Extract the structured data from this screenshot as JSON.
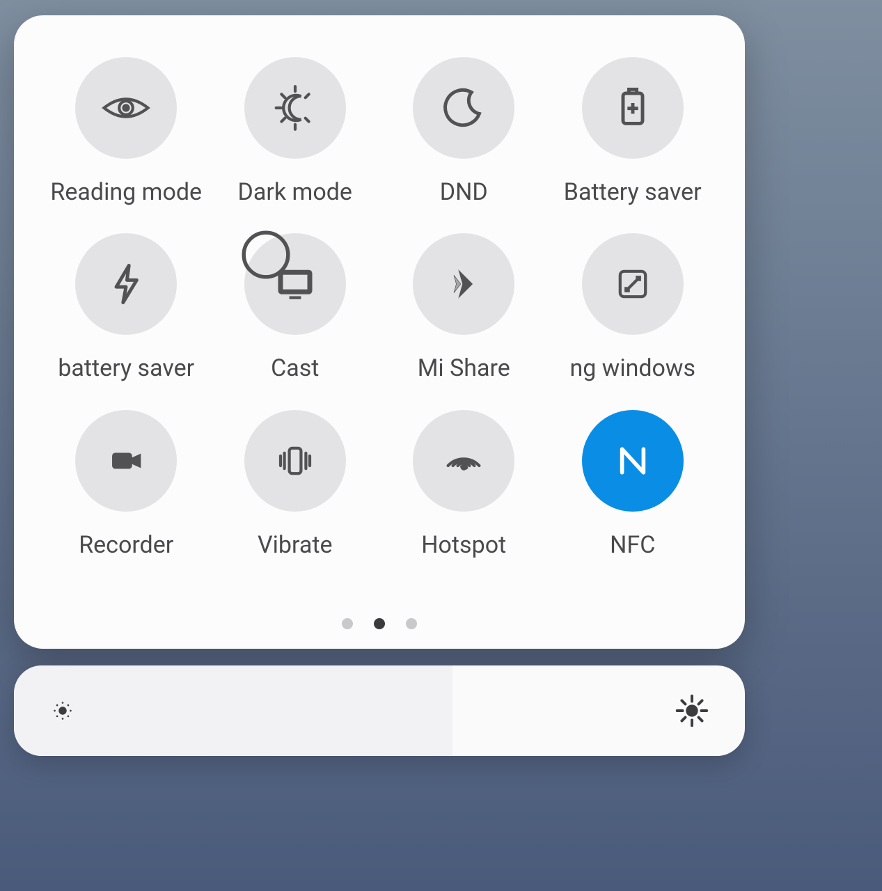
{
  "tiles": [
    {
      "id": "reading-mode",
      "label": "Reading mode",
      "icon": "eye-icon",
      "active": false,
      "highlight": false
    },
    {
      "id": "dark-mode",
      "label": "Dark mode",
      "icon": "dark-mode-icon",
      "active": false,
      "highlight": false
    },
    {
      "id": "dnd",
      "label": "DND",
      "icon": "moon-icon",
      "active": false,
      "highlight": false
    },
    {
      "id": "battery-saver",
      "label": "Battery saver",
      "icon": "battery-plus-icon",
      "active": false,
      "highlight": false
    },
    {
      "id": "ultra-battery",
      "label": "battery saver",
      "icon": "bolt-icon",
      "active": false,
      "highlight": false
    },
    {
      "id": "cast",
      "label": "Cast",
      "icon": "cast-icon",
      "active": false,
      "highlight": true
    },
    {
      "id": "mi-share",
      "label": "Mi Share",
      "icon": "mishare-icon",
      "active": false,
      "highlight": false
    },
    {
      "id": "floating-win",
      "label": "ng windows",
      "icon": "floating-window-icon",
      "active": false,
      "highlight": false
    },
    {
      "id": "recorder",
      "label": "Recorder",
      "icon": "camera-icon",
      "active": false,
      "highlight": false
    },
    {
      "id": "vibrate",
      "label": "Vibrate",
      "icon": "vibrate-icon",
      "active": false,
      "highlight": false
    },
    {
      "id": "hotspot",
      "label": "Hotspot",
      "icon": "hotspot-icon",
      "active": false,
      "highlight": false
    },
    {
      "id": "nfc",
      "label": "NFC",
      "icon": "nfc-icon",
      "active": true,
      "highlight": false
    }
  ],
  "pagination": {
    "pages": 3,
    "current": 1
  },
  "brightness": {
    "percent": 60
  },
  "colors": {
    "accent": "#0a8ee5",
    "highlight_ring": "#f03a2e",
    "tile_bg": "#e3e3e5"
  }
}
